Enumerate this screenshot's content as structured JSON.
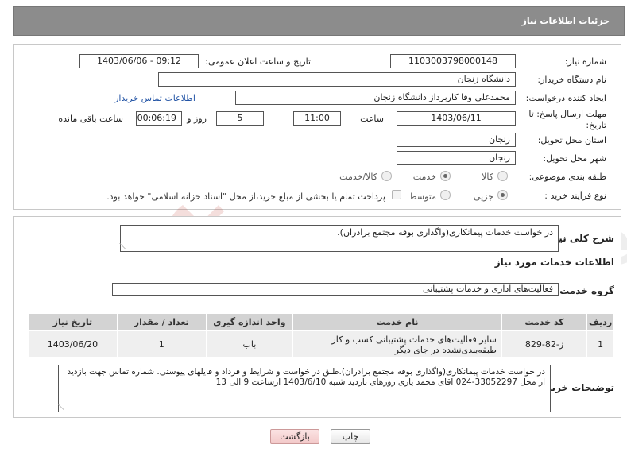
{
  "header": {
    "title": "جزئیات اطلاعات نیاز"
  },
  "form": {
    "need_number_label": "شماره نیاز:",
    "need_number": "1103003798000148",
    "announce_label": "تاریخ و ساعت اعلان عمومی:",
    "announce_value": "1403/06/06 - 09:12",
    "buyer_org_label": "نام دستگاه خریدار:",
    "buyer_org": "دانشگاه زنجان",
    "requester_label": "ایجاد کننده درخواست:",
    "requester": "محمدعلي وفا کاربرداز دانشگاه زنجان",
    "contact_link": "اطلاعات تماس خریدار",
    "deadline_label_1": "مهلت ارسال پاسخ: تا",
    "deadline_label_2": "تاریخ:",
    "deadline_date": "1403/06/11",
    "hour_label": "ساعت",
    "deadline_hour": "11:00",
    "days_value": "5",
    "days_label": "روز و",
    "remaining_time": "00:06:19",
    "remaining_label": "ساعت باقی مانده",
    "province_label": "استان محل تحویل:",
    "province": "زنجان",
    "city_label": "شهر محل تحویل:",
    "city": "زنجان",
    "category_label": "طبقه بندی موضوعی:",
    "category_options": [
      "کالا",
      "خدمت",
      "کالا/خدمت"
    ],
    "category_selected": "خدمت",
    "process_label": "نوع فرآیند خرید :",
    "process_options": [
      "جزیی",
      "متوسط"
    ],
    "process_selected": "جزیی",
    "treasury_note": "پرداخت تمام یا بخشی از مبلغ خرید،از محل \"اسناد خزانه اسلامی\" خواهد بود."
  },
  "summary": {
    "label": "شرح کلی نیاز:",
    "text": "در خواست خدمات پیمانکاری(واگذاری بوفه مجتمع  برادران)."
  },
  "services": {
    "section_title": "اطلاعات خدمات مورد نیاز",
    "group_label": "گروه خدمت:",
    "group_value": "فعالیت‌های اداری و خدمات پشتیبانی",
    "columns": [
      "ردیف",
      "کد خدمت",
      "نام خدمت",
      "واحد اندازه گیری",
      "تعداد / مقدار",
      "تاریخ نیاز"
    ],
    "rows": [
      {
        "row": "1",
        "code": "ز-82-829",
        "name": "سایر فعالیت‌های خدمات پشتیبانی کسب و کار طبقه‌بندی‌نشده در جای دیگر",
        "unit": "باب",
        "qty": "1",
        "date": "1403/06/20"
      }
    ]
  },
  "buyer_notes": {
    "label": "توضیحات خریدار:",
    "text": "در خواست خدمات پیمانکاری(واگذاری بوفه مجتمع  برادران).طبق در خواست و شرایط و قرداد و فایلهای پیوستی. شماره تماس جهت بازدید از محل 33052297-024 اقای محمد یاری روزهای بازدید شنبه 1403/6/10  ازساعت 9 الی 13"
  },
  "buttons": {
    "print": "چاپ",
    "back": "بازگشت"
  },
  "watermark": {
    "text": "AriaTender.neT"
  },
  "colors": {
    "header_bg": "#8c8c8c",
    "link": "#2354a5",
    "back_button": "#f3c9c9",
    "watermark": "#c0392b"
  }
}
